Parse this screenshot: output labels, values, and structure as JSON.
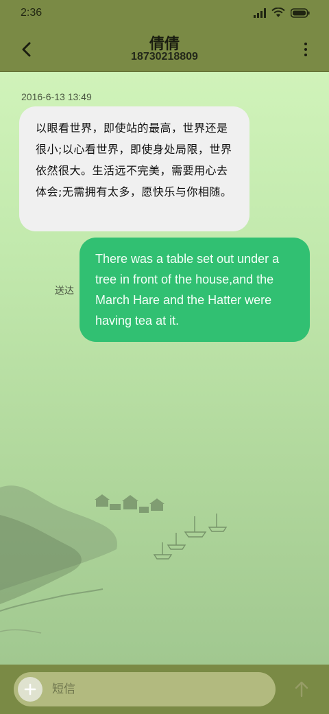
{
  "status_bar": {
    "time": "2:36",
    "icons": [
      "signal-icon",
      "wifi-icon",
      "battery-icon"
    ]
  },
  "header": {
    "contact_name": "倩倩",
    "phone_number": "18730218809",
    "back_icon": "back-arrow-icon",
    "menu_icon": "more-vert-icon"
  },
  "conversation": {
    "timestamp": "2016-6-13 13:49",
    "messages": [
      {
        "direction": "incoming",
        "text": "以眼看世界，即使站的最高，世界还是很小;以心看世界，即使身处局限，世界依然很大。生活远不完美，需要用心去体会;无需拥有太多，愿快乐与你相随。"
      },
      {
        "direction": "outgoing",
        "status": "送达",
        "text": "There was a table set out under a tree in front of the house,and the March Hare and the Hatter were having tea at it."
      }
    ]
  },
  "composer": {
    "placeholder": "短信",
    "add_icon": "plus-icon",
    "send_icon": "send-arrow-icon"
  },
  "colors": {
    "bar": "#7a8a45",
    "incoming_bubble": "#f0f0f0",
    "outgoing_bubble": "#31c072",
    "background_top": "#d6f7bf",
    "background_bottom": "#9dc48d"
  }
}
